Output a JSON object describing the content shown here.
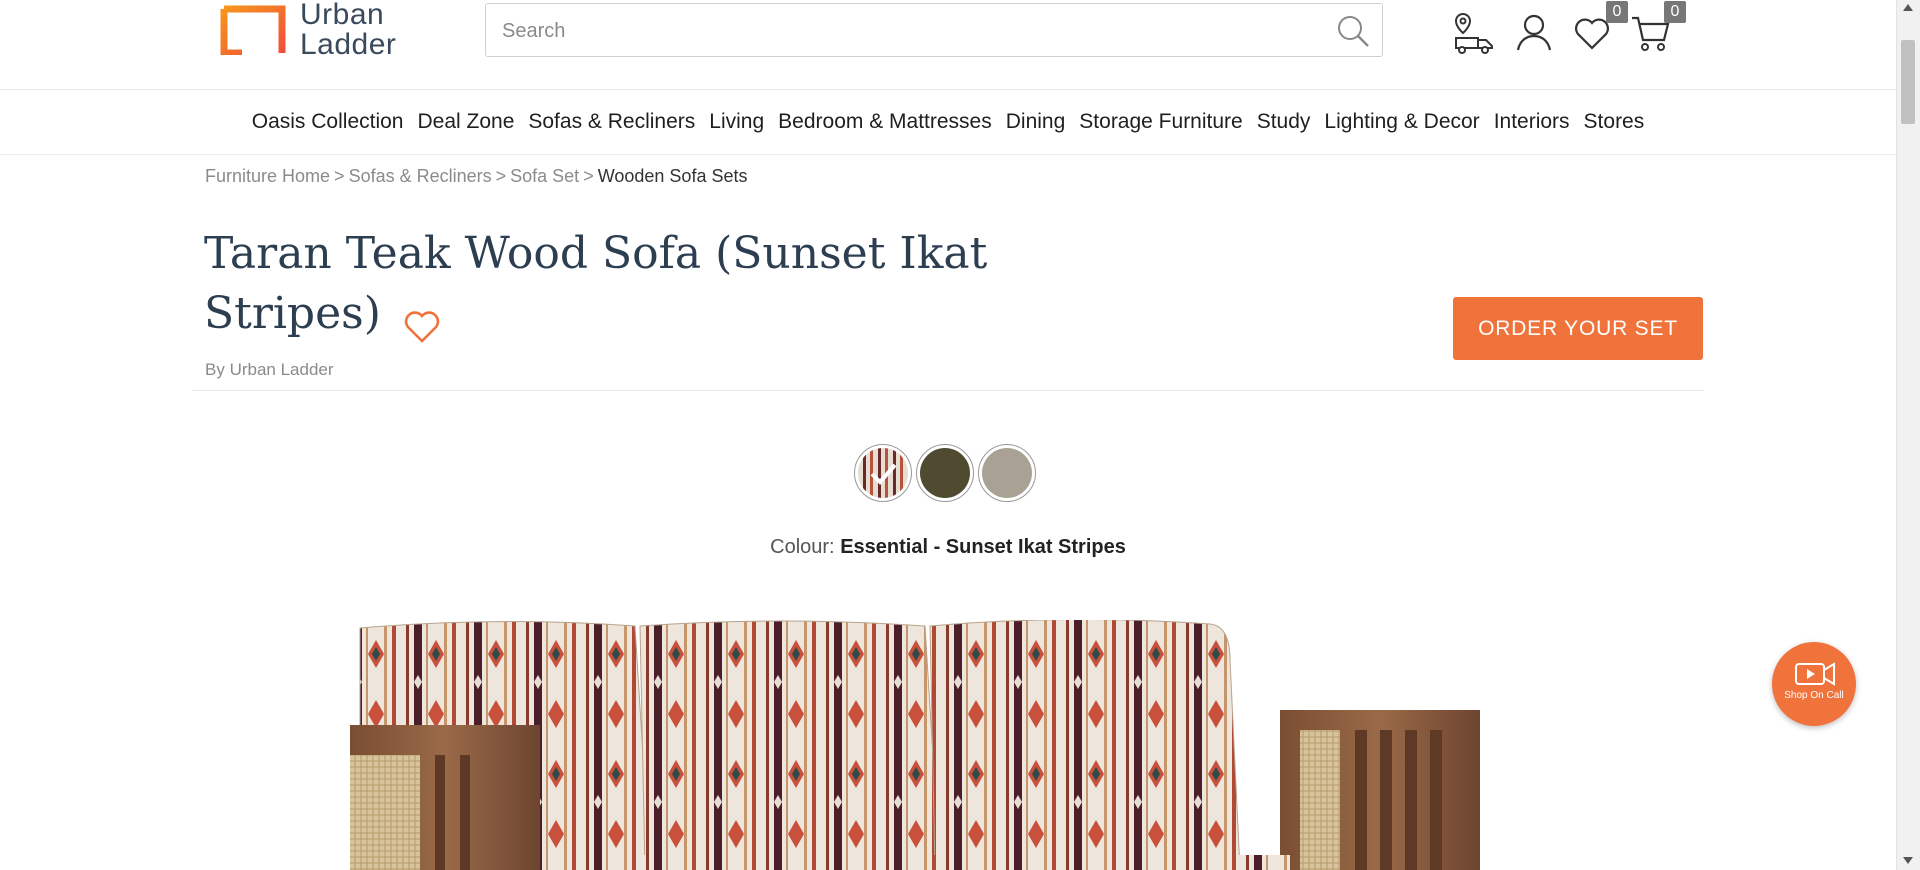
{
  "header": {
    "logo_line1": "Urban",
    "logo_line2": "Ladder",
    "search_placeholder": "Search",
    "wishlist_count": "0",
    "cart_count": "0",
    "icons": [
      "track-order-icon",
      "account-icon",
      "wishlist-icon",
      "cart-icon"
    ]
  },
  "nav": {
    "items": [
      "Oasis Collection",
      "Deal Zone",
      "Sofas & Recliners",
      "Living",
      "Bedroom & Mattresses",
      "Dining",
      "Storage Furniture",
      "Study",
      "Lighting & Decor",
      "Interiors",
      "Stores"
    ]
  },
  "breadcrumb": {
    "items": [
      "Furniture Home",
      "Sofas & Recliners",
      "Sofa Set"
    ],
    "separator": ">",
    "current": "Wooden Sofa Sets"
  },
  "product": {
    "title_line1": "Taran Teak Wood Sofa (Sunset Ikat",
    "title_line2": "Stripes)",
    "by_label": "By",
    "brand": "Urban Ladder",
    "order_button": "ORDER YOUR SET",
    "colour_label": "Colour:",
    "colour_value": "Essential - Sunset Ikat Stripes",
    "swatches": [
      {
        "name": "Sunset Ikat Stripes",
        "color": "#c9b3a6",
        "selected": true
      },
      {
        "name": "Olive",
        "color": "#4f4a30",
        "selected": false
      },
      {
        "name": "Beige",
        "color": "#a9a294",
        "selected": false
      }
    ]
  },
  "shop_on_call": {
    "label": "Shop On Call"
  },
  "colors": {
    "accent": "#f0733c",
    "title": "#2c3e50",
    "logo_orange": "#f0733c"
  }
}
